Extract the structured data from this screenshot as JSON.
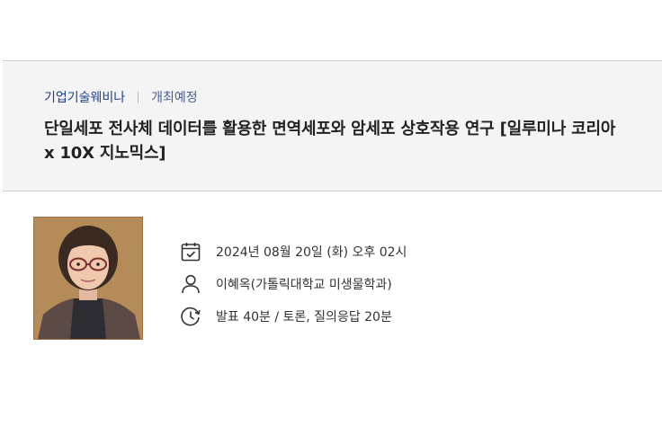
{
  "header": {
    "category": "기업기술웨비나",
    "status": "개최예정",
    "title": "단일세포 전사체 데이터를 활용한 면역세포와 암세포 상호작용 연구 [일루미나 코리아 x 10X 지노믹스]"
  },
  "details": {
    "datetime": "2024년 08월 20일 (화) 오후 02시",
    "speaker": "이혜옥(가톨릭대학교 미생물학과)",
    "duration": "발표 40분 / 토론, 질의응답 20분"
  },
  "icons": {
    "calendar": "calendar-check-icon",
    "person": "person-icon",
    "clock": "clock-icon"
  },
  "colors": {
    "accent": "#1e3f8a",
    "header_bg": "#f4f4f4"
  }
}
